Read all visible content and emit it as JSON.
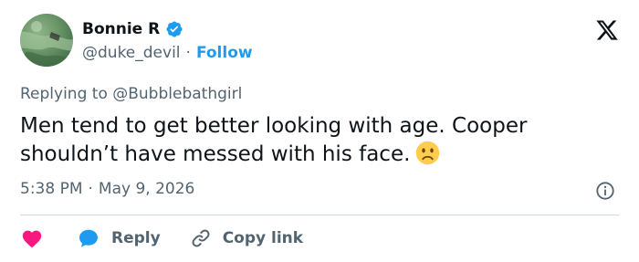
{
  "author": {
    "display_name": "Bonnie R",
    "handle": "@duke_devil",
    "separator": "·",
    "follow_label": "Follow"
  },
  "reply_context": {
    "prefix": "Replying to",
    "target": "@Bubblebathgirl"
  },
  "tweet": {
    "text": "Men tend to get better looking with age. Cooper shouldn’t have messed with his face.",
    "emoji": "slightly-frowning-face"
  },
  "meta": {
    "time": "5:38 PM",
    "separator": "·",
    "date": "May 9, 2026"
  },
  "actions": {
    "reply_label": "Reply",
    "copy_link_label": "Copy link"
  },
  "colors": {
    "accent": "#1d9bf0",
    "like": "#f91880",
    "secondary_text": "#536471",
    "primary_text": "#0f1419",
    "divider": "#cfd9de"
  },
  "icons": [
    "avatar-image",
    "verified-badge-icon",
    "x-logo-icon",
    "info-icon",
    "heart-icon",
    "reply-bubble-icon",
    "link-icon"
  ]
}
